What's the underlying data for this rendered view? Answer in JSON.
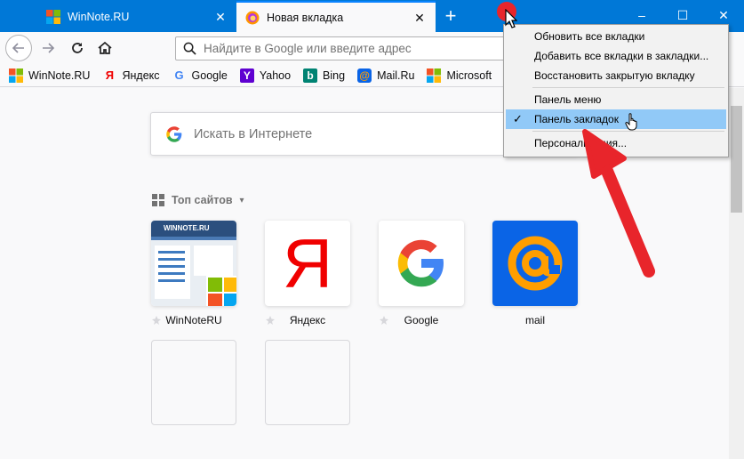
{
  "tabs": [
    {
      "title": "WinNote.RU",
      "active": false
    },
    {
      "title": "Новая вкладка",
      "active": true
    }
  ],
  "new_tab_label": "+",
  "window_controls": {
    "minimize": "–",
    "maximize": "☐",
    "close": "✕"
  },
  "urlbar": {
    "placeholder": "Найдите в Google или введите адрес"
  },
  "bookmarks": [
    {
      "label": "WinNote.RU",
      "icon": "microsoft-logo-icon"
    },
    {
      "label": "Яндекс",
      "icon": "yandex-icon"
    },
    {
      "label": "Google",
      "icon": "google-icon"
    },
    {
      "label": "Yahoo",
      "icon": "yahoo-icon"
    },
    {
      "label": "Bing",
      "icon": "bing-icon"
    },
    {
      "label": "Mail.Ru",
      "icon": "mailru-icon"
    },
    {
      "label": "Microsoft",
      "icon": "microsoft-logo-icon"
    }
  ],
  "search": {
    "placeholder": "Искать в Интернете"
  },
  "top_sites": {
    "header": "Топ сайтов",
    "items": [
      {
        "label": "WinNoteRU"
      },
      {
        "label": "Яндекс"
      },
      {
        "label": "Google"
      },
      {
        "label": "mail"
      }
    ]
  },
  "thumb": {
    "site_name": "WINNOTE.RU"
  },
  "context_menu": {
    "items": [
      {
        "label": "Обновить все вкладки",
        "checked": false,
        "highlighted": false
      },
      {
        "label": "Добавить все вкладки в закладки...",
        "checked": false,
        "highlighted": false
      },
      {
        "label": "Восстановить закрытую вкладку",
        "checked": false,
        "highlighted": false
      },
      {
        "label": "Панель меню",
        "checked": false,
        "highlighted": false
      },
      {
        "label": "Панель закладок",
        "checked": true,
        "highlighted": true
      },
      {
        "label": "Персонализация...",
        "checked": false,
        "highlighted": false
      }
    ],
    "check_glyph": "✓"
  },
  "colors": {
    "titlebar": "#0078d7",
    "menu_highlight": "#91c9f7",
    "arrow": "#e8252b",
    "yandex_red": "#f00000",
    "mail_blue": "#0a64e6",
    "mail_orange": "#ff9e00"
  },
  "letters": {
    "yandex_tile": "Я",
    "yandex_bm": "Я",
    "google_bm": "G",
    "yahoo_bm": "Y",
    "bing_bm": "b",
    "mailru_bm": "@"
  }
}
